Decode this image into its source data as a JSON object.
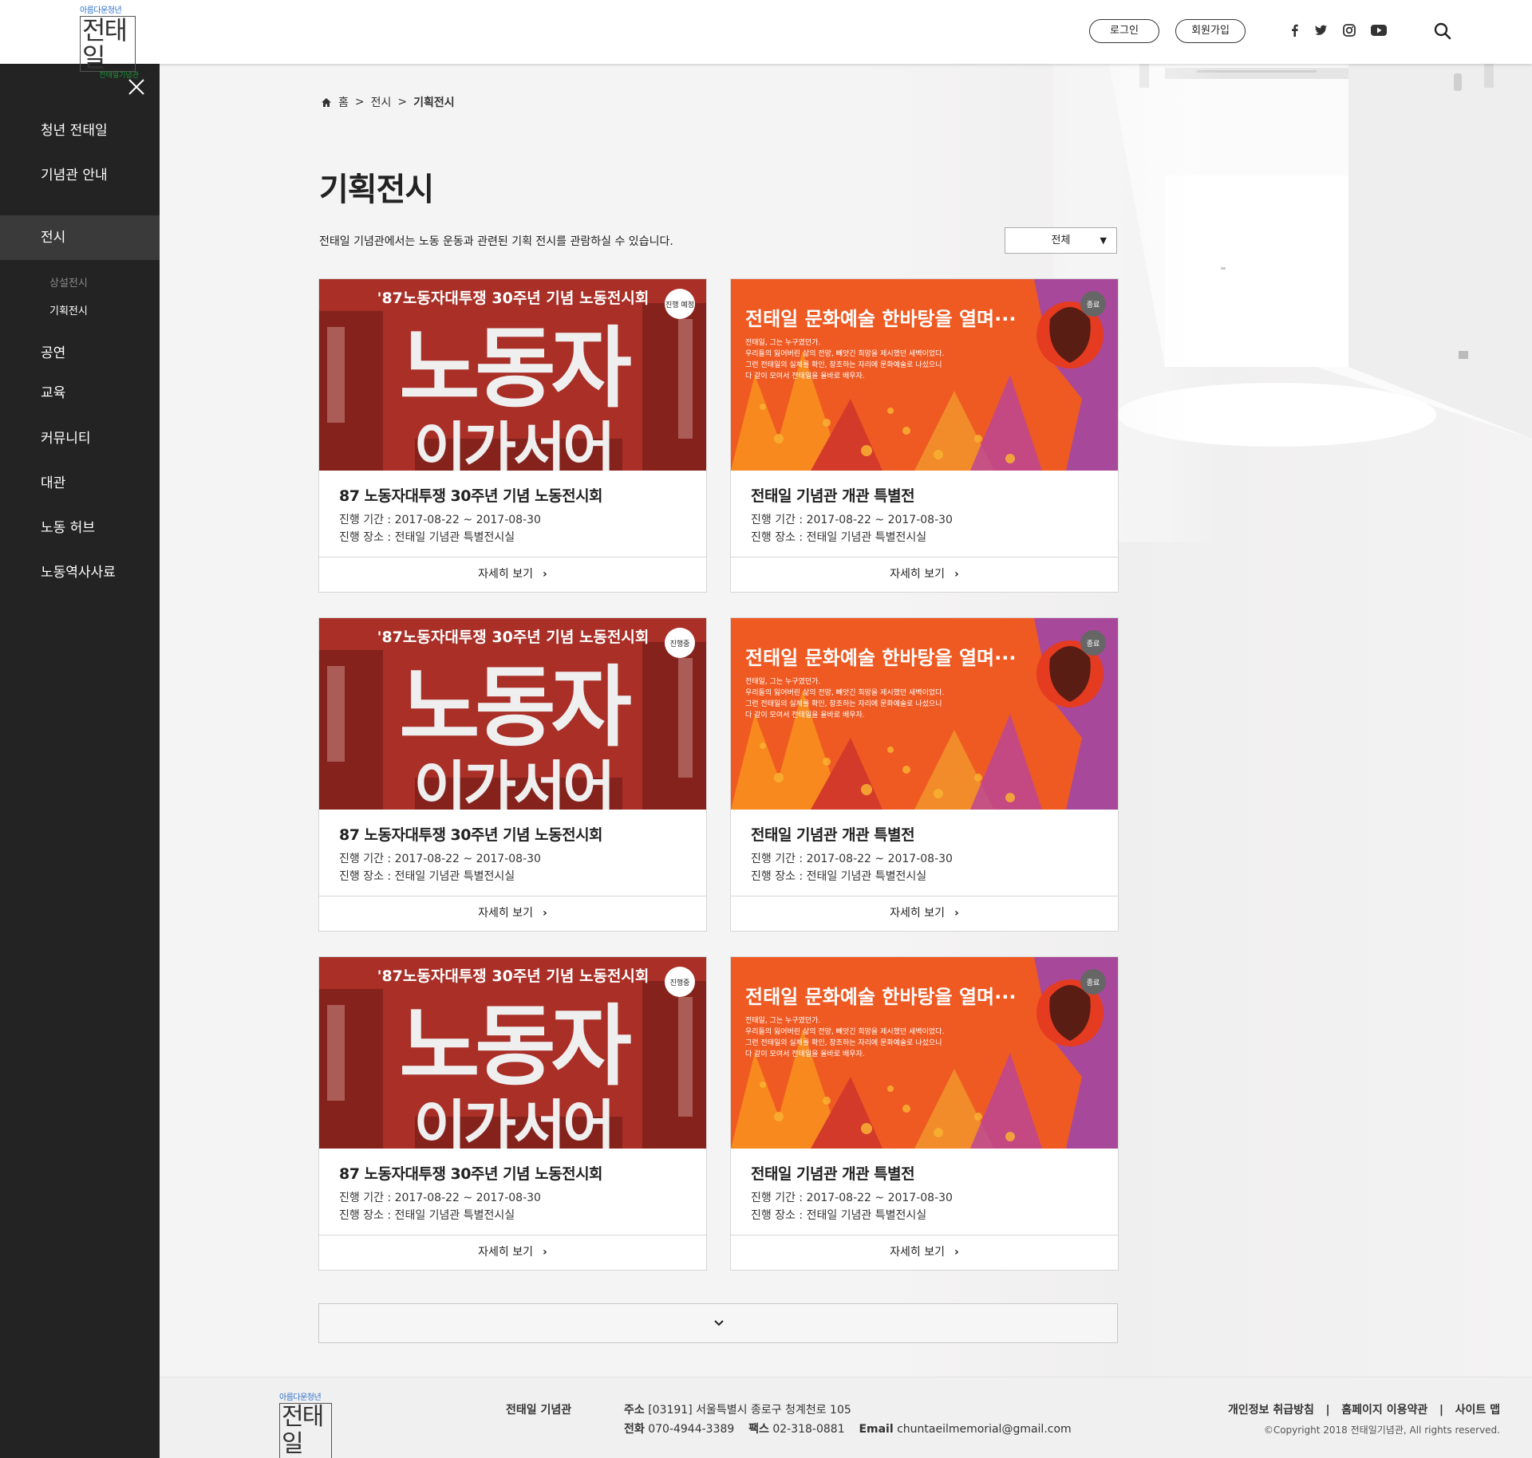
{
  "header": {
    "logo_top": "아름다운청년",
    "logo_main": "전태일",
    "logo_sub": "전태일기념관",
    "login": "로그인",
    "signup": "회원가입"
  },
  "sidebar": {
    "items": [
      "청년 전태일",
      "기념관 안내",
      "전시",
      "공연",
      "교육",
      "커뮤니티",
      "대관",
      "노동 허브",
      "노동역사사료"
    ],
    "sub_items": [
      "상설전시",
      "기획전시"
    ]
  },
  "breadcrumb": {
    "home": "홈",
    "level1": "전시",
    "level2": "기획전시",
    "sep": ">"
  },
  "page": {
    "title": "기획전시",
    "description": "전태일 기념관에서는 노동 운동과 관련된 기획 전시를 관람하실 수 있습니다.",
    "filter_value": "전체"
  },
  "poster_a": {
    "headline": "'87노동자대투쟁 30주년 기념 노동전시회",
    "big1": "노동자",
    "big2": "이가서어",
    "badges": [
      "진행\n예정",
      "진행중",
      "진행중"
    ]
  },
  "poster_b": {
    "headline": "전태일 문화예술 한바탕을 열며···",
    "body": [
      "전태일, 그는 누구였던가.",
      "우리들의 잃어버린 삶의 전망, 빼앗긴 희망을 제시했던 새벽이었다.",
      "그런 전태일의 실체를 확인, 창조하는 자리에 문화예술로 나섰으니",
      "다 같이 모여서 전태일을 올바로 배우자."
    ],
    "badge": "종료"
  },
  "cards": [
    {
      "title": "87 노동자대투쟁 30주년 기념 노동전시회",
      "period": "진행 기간 : 2017-08-22 ~ 2017-08-30",
      "place": "진행 장소 : 전태일 기념관 특별전시실",
      "more": "자세히 보기"
    },
    {
      "title": "전태일 기념관 개관 특별전",
      "period": "진행 기간 : 2017-08-22 ~ 2017-08-30",
      "place": "진행 장소 : 전태일 기념관 특별전시실",
      "more": "자세히 보기"
    },
    {
      "title": "87 노동자대투쟁 30주년 기념 노동전시회",
      "period": "진행 기간 : 2017-08-22 ~ 2017-08-30",
      "place": "진행 장소 : 전태일 기념관 특별전시실",
      "more": "자세히 보기"
    },
    {
      "title": "전태일 기념관 개관 특별전",
      "period": "진행 기간 : 2017-08-22 ~ 2017-08-30",
      "place": "진행 장소 : 전태일 기념관 특별전시실",
      "more": "자세히 보기"
    },
    {
      "title": "87 노동자대투쟁 30주년 기념 노동전시회",
      "period": "진행 기간 : 2017-08-22 ~ 2017-08-30",
      "place": "진행 장소 : 전태일 기념관 특별전시실",
      "more": "자세히 보기"
    },
    {
      "title": "전태일 기념관 개관 특별전",
      "period": "진행 기간 : 2017-08-22 ~ 2017-08-30",
      "place": "진행 장소 : 전태일 기념관 특별전시실",
      "more": "자세히 보기"
    }
  ],
  "footer": {
    "org": "전태일 기념관",
    "addr_label": "주소",
    "addr": "[03191] 서울특별시 종로구 청계천로 105",
    "tel_label": "전화",
    "tel": "070-4944-3389",
    "fax_label": "팩스",
    "fax": "02-318-0881",
    "email_label": "Email",
    "email": "chuntaeilmemorial@gmail.com",
    "privacy": "개인정보 취급방침",
    "terms": "홈페이지 이용약관",
    "sitemap": "사이트 맵",
    "link_sep": "|",
    "copyright": "©Copyright 2018 전태일기념관, All rights reserved."
  },
  "colors": {
    "sidebar": "#232323",
    "sidebar_active": "#3a3a3a",
    "poster_red": "#b3322a",
    "poster_orange": "#ef5a23",
    "poster_purple": "#a8489a"
  }
}
